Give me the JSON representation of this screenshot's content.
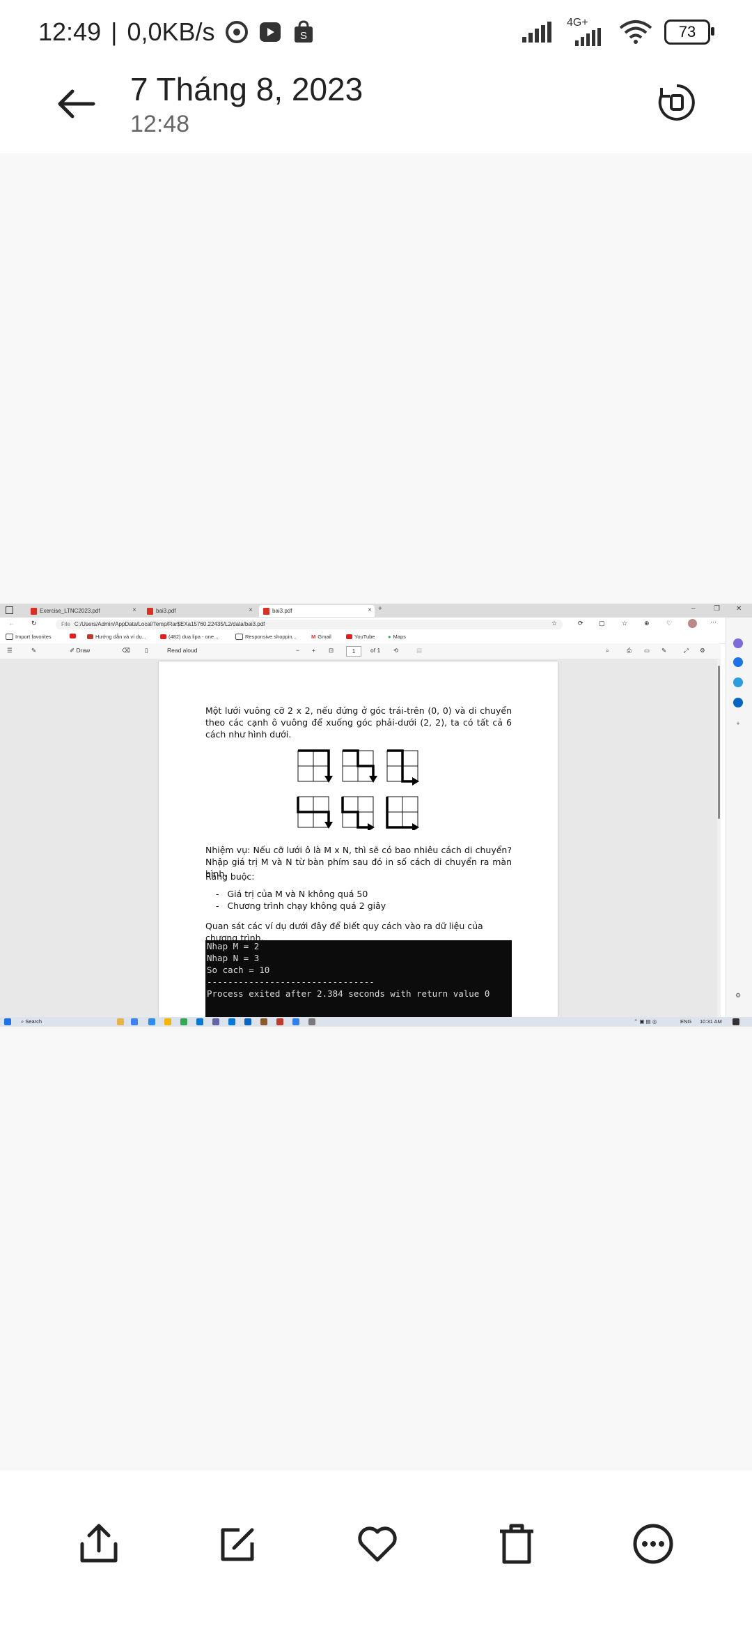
{
  "status": {
    "time": "12:49",
    "speed": "0,0KB/s",
    "network": "4G+",
    "battery": "73"
  },
  "header": {
    "title": "7 Tháng 8, 2023",
    "subtitle": "12:48",
    "back_icon": "back-arrow-icon",
    "rotate_icon": "rotate-icon"
  },
  "browser": {
    "tabs": [
      "Exercise_LTNC2023.pdf",
      "bai3.pdf",
      "bai3.pdf"
    ],
    "new_tab": "+",
    "url_prefix": "File",
    "url": "C:/Users/Admin/AppData/Local/Temp/Rar$EXa15760.22435/L2/data/bai3.pdf",
    "favorites": [
      "Import favorites",
      "Hướng dẫn và ví dụ...",
      "(482) dua lipa - one...",
      "Responsive shoppin...",
      "Gmail",
      "YouTube",
      "Maps"
    ],
    "pdf_toolbar": {
      "draw": "Draw",
      "read_aloud": "Read aloud",
      "minus": "−",
      "plus": "+",
      "page": "1",
      "of_pages": "of 1"
    }
  },
  "pdf": {
    "intro": "Một lưới vuông cỡ 2 x 2, nếu đứng ở góc trái-trên (0, 0) và di chuyển theo các cạnh ô vuông để xuống góc phải-dưới (2, 2), ta có tất cả 6 cách như hình dưới.",
    "task": "Nhiệm vụ: Nếu cỡ lưới ô là M x N, thì sẽ có bao nhiêu cách di chuyển? Nhập giá trị M và N từ bàn phím sau đó in số cách di chuyển ra màn hình.",
    "constraints_title": "Ràng buộc:",
    "constraints": [
      "Giá trị của M và N không quá 50",
      "Chương trình chạy không quá 2 giây"
    ],
    "examples_intro": "Quan sát các ví dụ dưới đây để biết quy cách vào ra dữ liệu của chương trình.",
    "console": [
      "Nhap M = 2",
      "Nhap N = 3",
      "So cach = 10",
      "--------------------------------",
      "Process exited after 2.384 seconds with return value 0"
    ]
  },
  "taskbar": {
    "search": "Search",
    "lang": "ENG",
    "time": "10:31 AM"
  },
  "actions": [
    "share-icon",
    "edit-icon",
    "heart-icon",
    "delete-icon",
    "more-icon"
  ]
}
